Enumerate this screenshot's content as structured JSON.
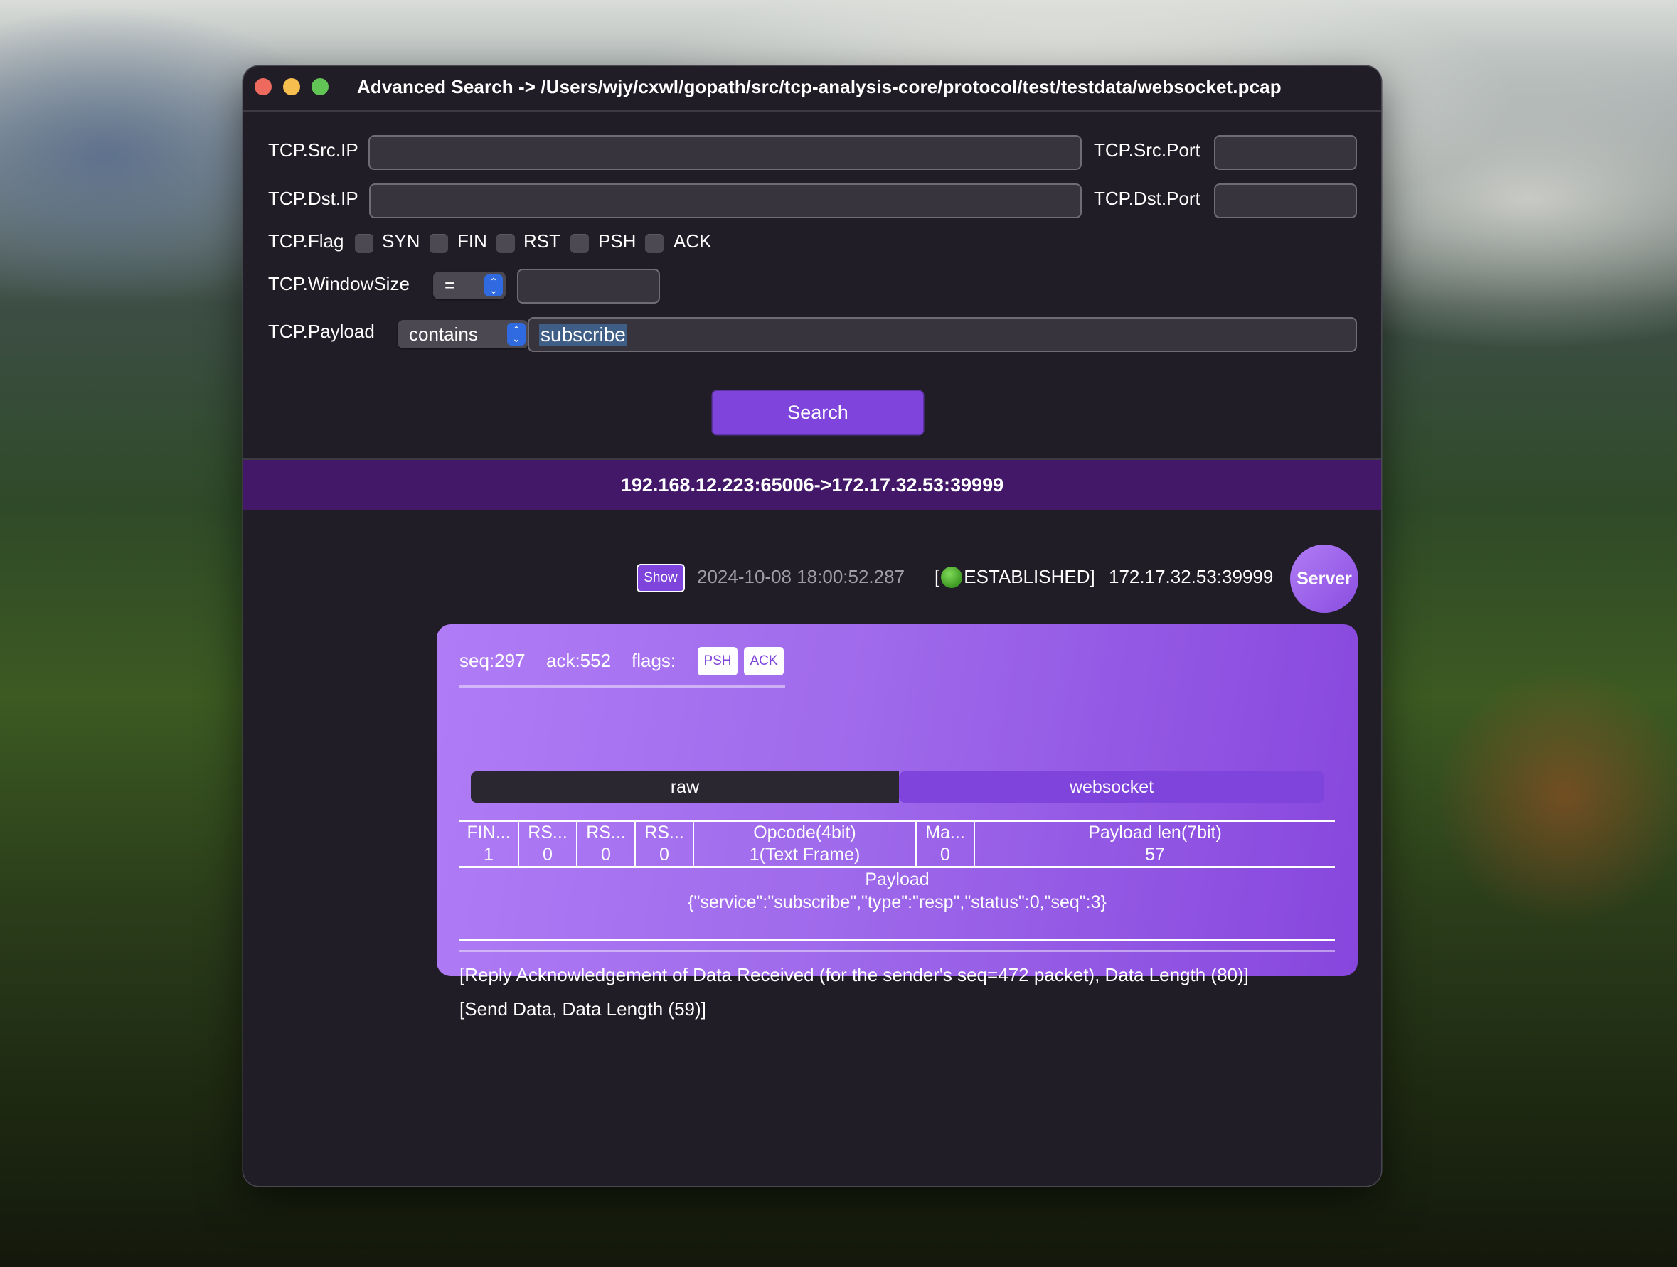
{
  "window": {
    "title": "Advanced Search -> /Users/wjy/cxwl/gopath/src/tcp-analysis-core/protocol/test/testdata/websocket.pcap",
    "controls": [
      "close",
      "minimize",
      "zoom"
    ]
  },
  "form": {
    "src_ip": {
      "label": "TCP.Src.IP",
      "value": ""
    },
    "src_port": {
      "label": "TCP.Src.Port",
      "value": ""
    },
    "dst_ip": {
      "label": "TCP.Dst.IP",
      "value": ""
    },
    "dst_port": {
      "label": "TCP.Dst.Port",
      "value": ""
    },
    "flag": {
      "label": "TCP.Flag",
      "options": [
        {
          "label": "SYN",
          "checked": false
        },
        {
          "label": "FIN",
          "checked": false
        },
        {
          "label": "RST",
          "checked": false
        },
        {
          "label": "PSH",
          "checked": false
        },
        {
          "label": "ACK",
          "checked": false
        }
      ]
    },
    "window_size": {
      "label": "TCP.WindowSize",
      "operator": "=",
      "value": ""
    },
    "payload": {
      "label": "TCP.Payload",
      "operator": "contains",
      "value": "subscribe"
    },
    "search_label": "Search"
  },
  "connection": {
    "header": "192.168.12.223:65006->172.17.32.53:39999"
  },
  "packet": {
    "show_label": "Show",
    "timestamp": "2024-10-08 18:00:52.287",
    "state_open": "[",
    "state": "ESTABLISHED]",
    "state_color": "#4caf2a",
    "endpoint": "172.17.32.53:39999",
    "role": "Server",
    "seq": "seq:297",
    "ack": "ack:552",
    "flags_label": "flags:",
    "flags": [
      "PSH",
      "ACK"
    ],
    "tabs": [
      {
        "label": "raw",
        "active": false
      },
      {
        "label": "websocket",
        "active": true
      }
    ],
    "ws_frame": {
      "headers": [
        "FIN...",
        "RS...",
        "RS...",
        "RS...",
        "Opcode(4bit)",
        "Ma...",
        "Payload len(7bit)"
      ],
      "values": [
        "1",
        "0",
        "0",
        "0",
        "1(Text Frame)",
        "0",
        "57"
      ]
    },
    "payload_title": "Payload",
    "payload_body": "{\"service\":\"subscribe\",\"type\":\"resp\",\"status\":0,\"seq\":3}",
    "notes": [
      "[Reply Acknowledgement of Data Received (for the sender's seq=472 packet), Data Length (80)]",
      "[Send Data, Data Length (59)]"
    ]
  },
  "colors": {
    "accent": "#7f44dc",
    "banner": "#431869",
    "window_bg": "#211d27"
  }
}
